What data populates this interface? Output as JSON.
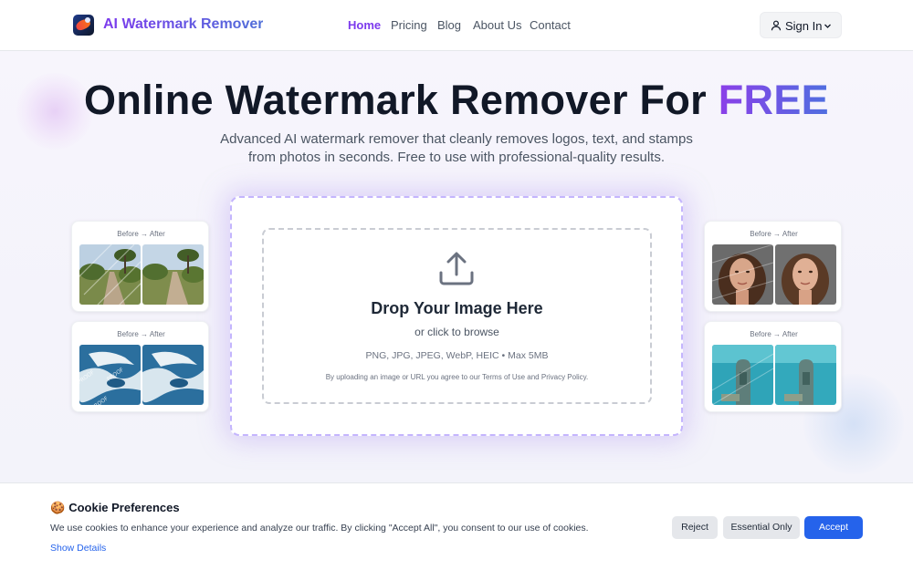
{
  "header": {
    "app_name": "AI Watermark Remover",
    "nav": [
      {
        "label": "Home",
        "active": true
      },
      {
        "label": "Pricing",
        "active": false
      },
      {
        "label": "Blog",
        "active": false
      },
      {
        "label": "About Us",
        "active": false
      },
      {
        "label": "Contact",
        "active": false
      }
    ],
    "signin_label": "Sign In"
  },
  "hero": {
    "title_main": "Online Watermark Remover For ",
    "title_highlight": "FREE",
    "subtitle": "Advanced AI watermark remover that cleanly removes logos, text, and stamps from photos in seconds. Free to use with professional-quality results."
  },
  "upload": {
    "title": "Drop Your Image Here",
    "browse_text": "or click to browse",
    "formats": "PNG, JPG, JPEG, WebP, HEIC • Max 5MB",
    "terms": "By uploading an image or URL you agree to our Terms of Use and Privacy Policy."
  },
  "examples": [
    {
      "caption": "Before → After",
      "subject": "road-trees"
    },
    {
      "caption": "Before → After",
      "subject": "aerial-coast"
    },
    {
      "caption": "Before → After",
      "subject": "portrait"
    },
    {
      "caption": "Before → After",
      "subject": "underwater"
    }
  ],
  "cookie": {
    "emoji": "🍪",
    "title": "Cookie Preferences",
    "text": "We use cookies to enhance your experience and analyze our traffic. By clicking \"Accept All\", you consent to our use of cookies.",
    "details_link": "Show Details",
    "buttons": {
      "reject": "Reject",
      "essential": "Essential Only",
      "accept": "Accept"
    }
  },
  "colors": {
    "brand_purple": "#7c3aed",
    "brand_blue": "#4f6fd8",
    "accept_blue": "#2563eb"
  }
}
